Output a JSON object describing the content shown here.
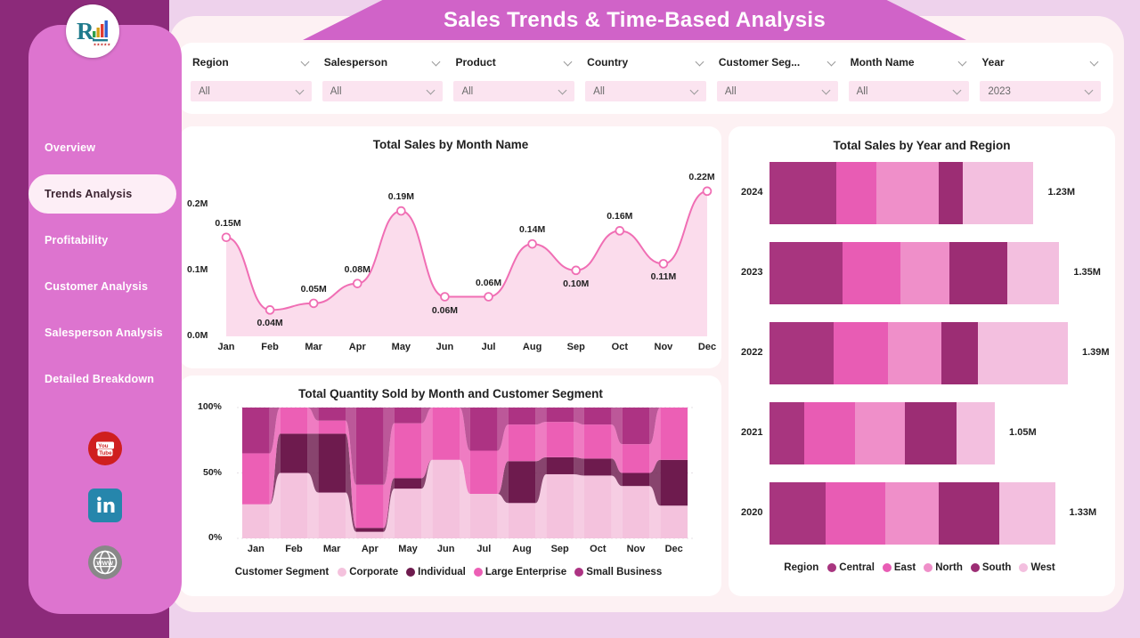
{
  "app": {
    "header_title": "Sales Trends & Time-Based Analysis"
  },
  "sidebar": {
    "logo_name": "company-logo",
    "items": [
      {
        "label": "Overview",
        "active": false
      },
      {
        "label": "Trends Analysis",
        "active": true
      },
      {
        "label": "Profitability",
        "active": false
      },
      {
        "label": "Customer Analysis",
        "active": false
      },
      {
        "label": "Salesperson Analysis",
        "active": false
      },
      {
        "label": "Detailed Breakdown",
        "active": false
      }
    ],
    "socials": [
      {
        "name": "youtube-icon",
        "label": "YouTube"
      },
      {
        "name": "linkedin-icon",
        "label": "LinkedIn"
      },
      {
        "name": "website-icon",
        "label": "WWW"
      }
    ]
  },
  "slicers": [
    {
      "title": "Region",
      "value": "All"
    },
    {
      "title": "Salesperson",
      "value": "All"
    },
    {
      "title": "Product",
      "value": "All"
    },
    {
      "title": "Country",
      "value": "All"
    },
    {
      "title": "Customer Seg...",
      "value": "All"
    },
    {
      "title": "Month Name",
      "value": "All"
    },
    {
      "title": "Year",
      "value": "2023"
    }
  ],
  "colors": {
    "brand_purple": "#8c2a7a",
    "sidebar_pink": "#dd74cf",
    "banner_pink": "#d063c8",
    "canvas_bg": "#eed2ec",
    "panel_bg": "#fdf1f3",
    "line_stroke": "#f06eb4",
    "line_fill": "#fbdcec",
    "central": "#a8357f",
    "east": "#e85cb4",
    "north": "#ef8fc9",
    "south": "#9c2d74",
    "west": "#f3bfdf",
    "corporate": "#f4c2dd",
    "individual": "#6e1b4e",
    "large_enterprise": "#ec5fb5",
    "small_business": "#ad3383"
  },
  "chart_data": [
    {
      "type": "line",
      "title": "Total Sales by Month Name",
      "xlabel": "",
      "ylabel": "",
      "categories": [
        "Jan",
        "Feb",
        "Mar",
        "Apr",
        "May",
        "Jun",
        "Jul",
        "Aug",
        "Sep",
        "Oct",
        "Nov",
        "Dec"
      ],
      "values": [
        0.15,
        0.04,
        0.05,
        0.08,
        0.19,
        0.06,
        0.06,
        0.14,
        0.1,
        0.16,
        0.11,
        0.22
      ],
      "data_labels": [
        "0.15M",
        "0.04M",
        "0.05M",
        "0.08M",
        "0.19M",
        "0.06M",
        "0.06M",
        "0.14M",
        "0.10M",
        "0.16M",
        "0.11M",
        "0.22M"
      ],
      "label_above": [
        true,
        false,
        true,
        true,
        true,
        false,
        true,
        true,
        false,
        true,
        false,
        true
      ],
      "ylim": [
        0.0,
        0.24
      ],
      "ytick_labels": [
        "0.0M",
        "0.1M",
        "0.2M"
      ],
      "ytick_values": [
        0.0,
        0.1,
        0.2
      ],
      "grid": false,
      "legend": "none"
    },
    {
      "type": "area",
      "title": "Total Quantity Sold by Month and Customer Segment",
      "subtype": "100% stacked ribbon",
      "xlabel": "",
      "ylabel": "",
      "categories": [
        "Jan",
        "Feb",
        "Mar",
        "Apr",
        "May",
        "Jun",
        "Jul",
        "Aug",
        "Sep",
        "Oct",
        "Nov",
        "Dec"
      ],
      "ytick_labels": [
        "0%",
        "50%",
        "100%"
      ],
      "ytick_values": [
        0,
        50,
        100
      ],
      "ylim": [
        0,
        100
      ],
      "legend_title": "Customer Segment",
      "legend_position": "bottom",
      "series": [
        {
          "name": "Corporate",
          "color": "#f4c2dd",
          "values": [
            26,
            50,
            35,
            5,
            38,
            60,
            34,
            27,
            49,
            48,
            40,
            25
          ]
        },
        {
          "name": "Individual",
          "color": "#6e1b4e",
          "values": [
            0,
            30,
            45,
            3,
            8,
            0,
            0,
            32,
            13,
            13,
            10,
            35
          ]
        },
        {
          "name": "Large Enterprise",
          "color": "#ec5fb5",
          "values": [
            39,
            20,
            10,
            33,
            42,
            40,
            33,
            28,
            27,
            26,
            22,
            40
          ]
        },
        {
          "name": "Small Business",
          "color": "#ad3383",
          "values": [
            35,
            0,
            10,
            59,
            12,
            0,
            33,
            13,
            11,
            13,
            28,
            0
          ]
        }
      ]
    },
    {
      "type": "bar",
      "subtype": "horizontal stacked",
      "title": "Total Sales by Year and Region",
      "xlabel": "",
      "ylabel": "",
      "categories": [
        "2024",
        "2023",
        "2022",
        "2021",
        "2020"
      ],
      "totals": [
        1.23,
        1.35,
        1.39,
        1.05,
        1.33
      ],
      "total_labels": [
        "1.23M",
        "1.35M",
        "1.39M",
        "1.05M",
        "1.33M"
      ],
      "legend_title": "Region",
      "legend_position": "bottom",
      "series": [
        {
          "name": "Central",
          "color": "#a8357f",
          "values": [
            0.31,
            0.34,
            0.3,
            0.16,
            0.26
          ]
        },
        {
          "name": "East",
          "color": "#e85cb4",
          "values": [
            0.19,
            0.27,
            0.25,
            0.24,
            0.28
          ]
        },
        {
          "name": "North",
          "color": "#ef8fc9",
          "values": [
            0.29,
            0.23,
            0.25,
            0.23,
            0.25
          ]
        },
        {
          "name": "South",
          "color": "#9c2d74",
          "values": [
            0.11,
            0.27,
            0.17,
            0.24,
            0.28
          ]
        },
        {
          "name": "West",
          "color": "#f3bfdf",
          "values": [
            0.33,
            0.24,
            0.42,
            0.18,
            0.26
          ]
        }
      ],
      "max_total": 1.39
    }
  ]
}
